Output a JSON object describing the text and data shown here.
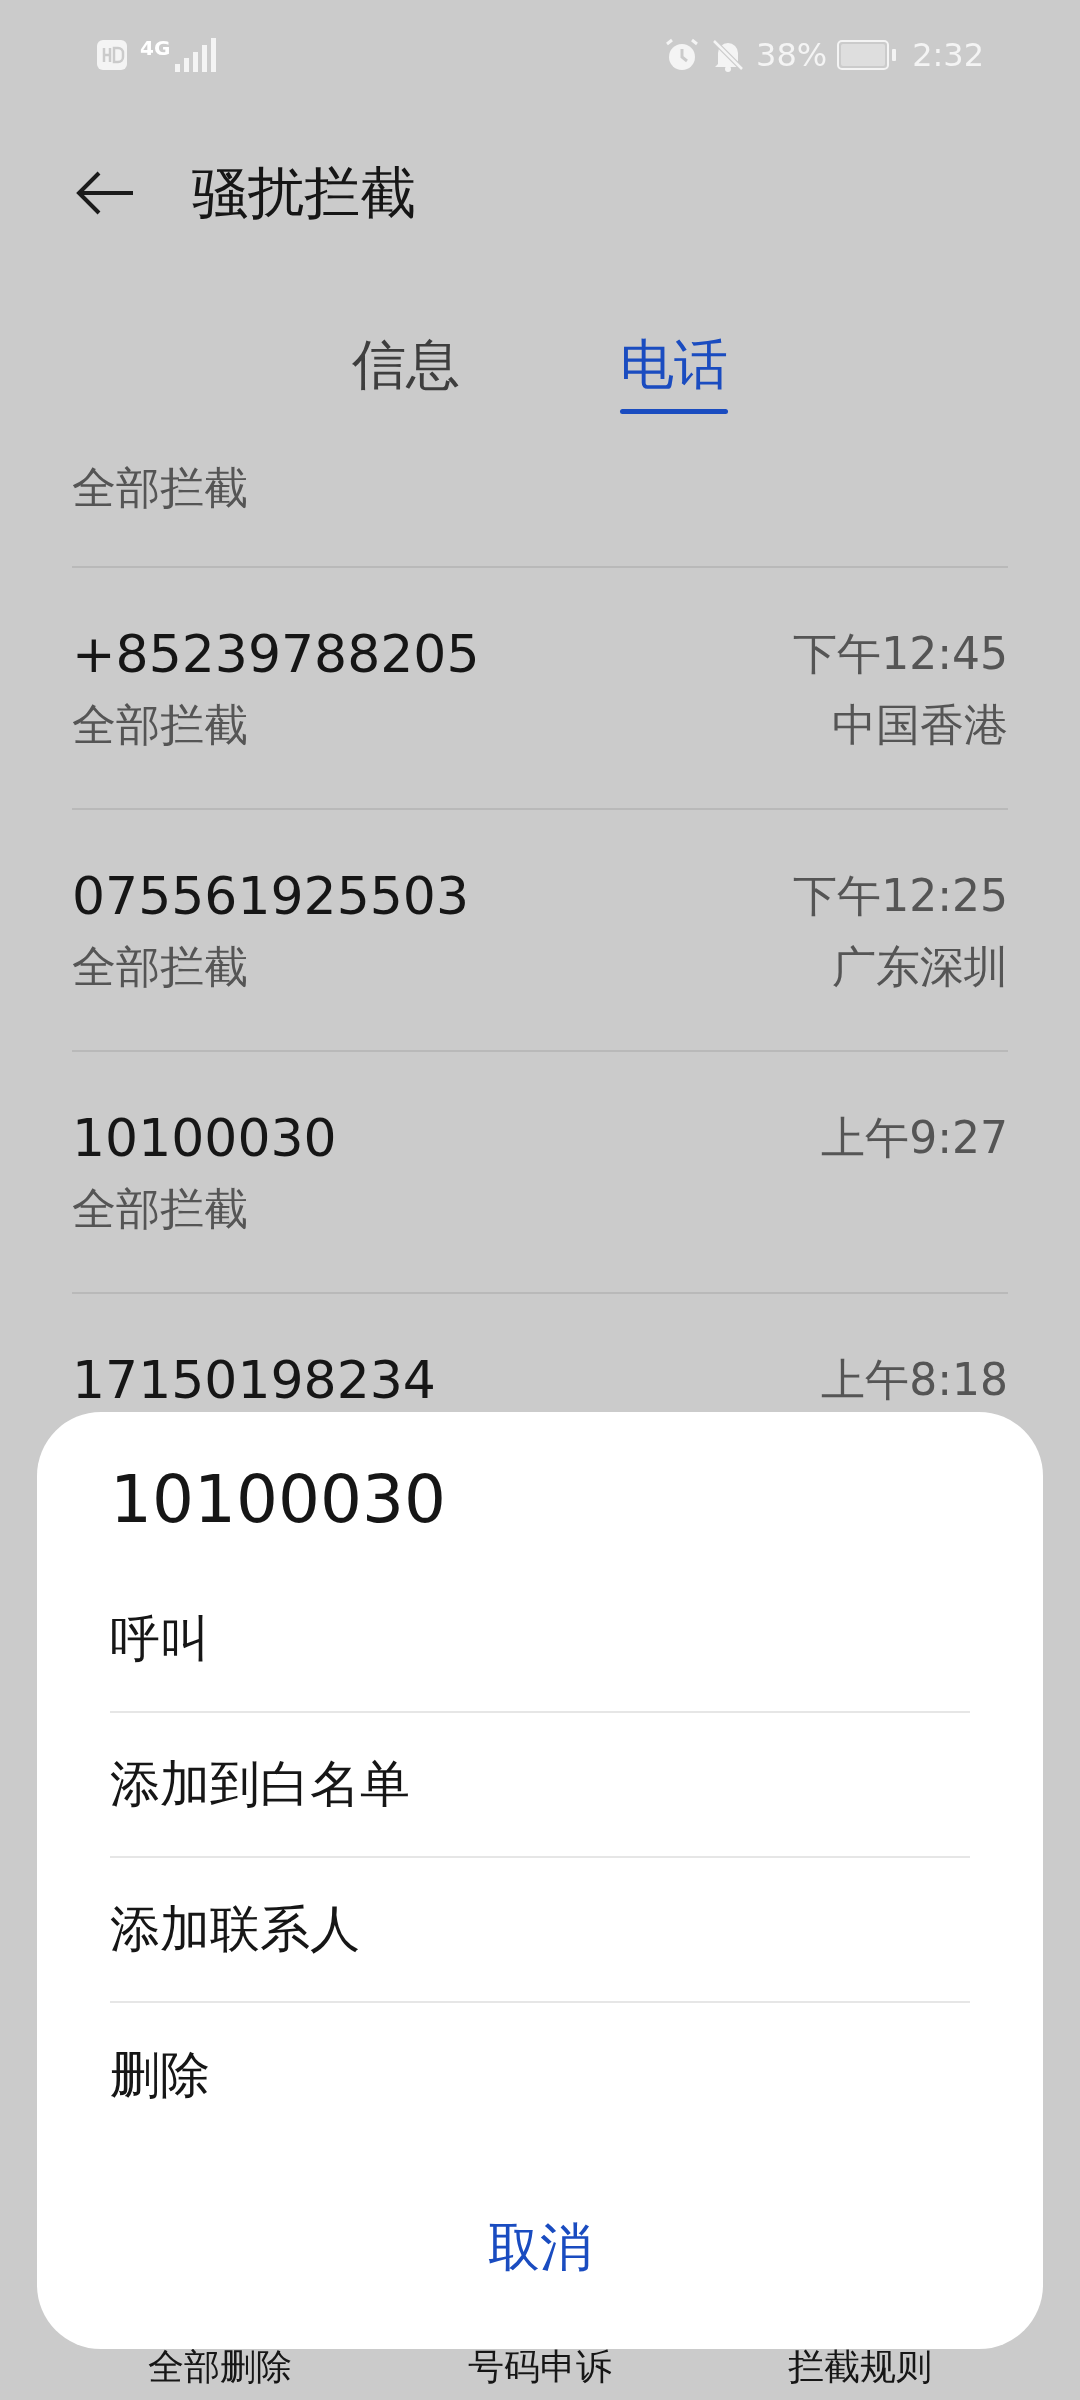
{
  "status_bar": {
    "network": "4G",
    "battery": "38%",
    "time": "2:32"
  },
  "header": {
    "title": "骚扰拦截"
  },
  "tabs": [
    {
      "label": "信息",
      "selected": false
    },
    {
      "label": "电话",
      "selected": true
    }
  ],
  "filter": {
    "label": "全部拦截"
  },
  "calls": [
    {
      "number": "+85239788205",
      "time": "下午12:45",
      "type": "全部拦截",
      "location": "中国香港"
    },
    {
      "number": "075561925503",
      "time": "下午12:25",
      "type": "全部拦截",
      "location": "广东深圳"
    },
    {
      "number": "10100030",
      "time": "上午9:27",
      "type": "全部拦截"
    },
    {
      "number": "17150198234",
      "time": "上午8:18"
    }
  ],
  "bottom_bar": [
    {
      "label": "全部删除"
    },
    {
      "label": "号码申诉"
    },
    {
      "label": "拦截规则"
    }
  ],
  "sheet": {
    "title": "10100030",
    "actions": [
      {
        "label": "呼叫"
      },
      {
        "label": "添加到白名单"
      },
      {
        "label": "添加联系人"
      },
      {
        "label": "删除"
      }
    ],
    "cancel": "取消"
  }
}
